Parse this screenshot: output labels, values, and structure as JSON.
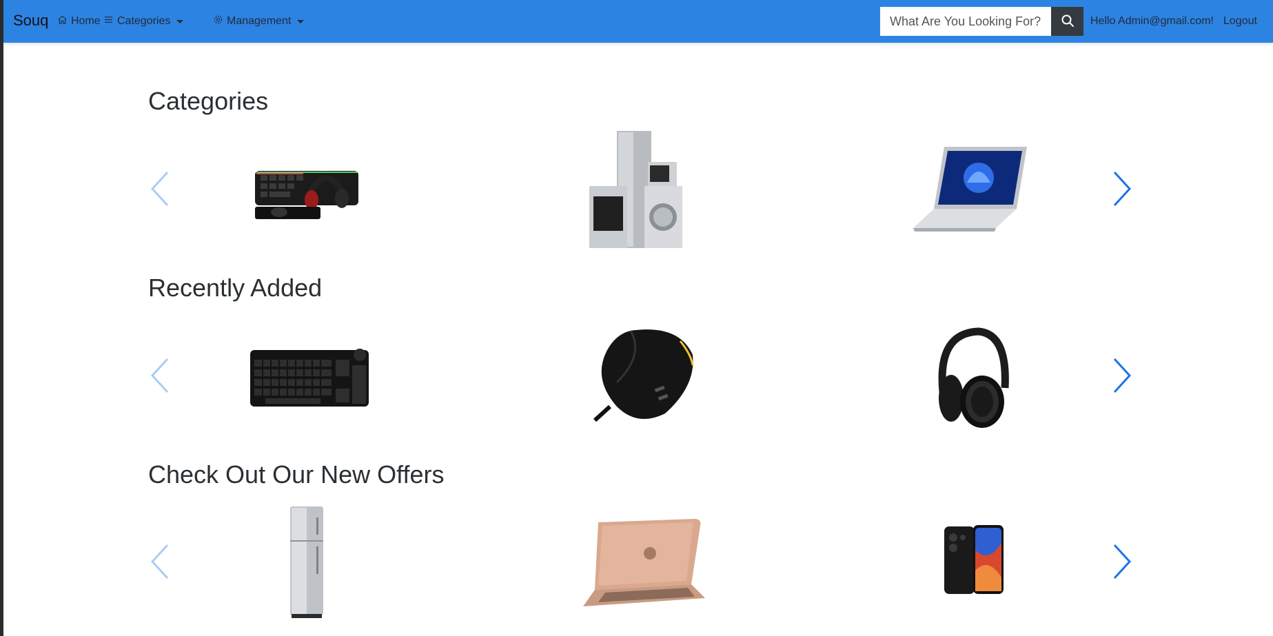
{
  "navbar": {
    "brand": "Souq",
    "home_label": "Home",
    "categories_label": "Categories",
    "management_label": "Management",
    "search_placeholder": "What Are You Looking For?",
    "greeting": "Hello Admin@gmail.com!",
    "logout_label": "Logout"
  },
  "sections": {
    "categories": {
      "title": "Categories",
      "items": [
        "gaming-peripherals-image",
        "home-appliances-image",
        "laptop-image"
      ]
    },
    "recent": {
      "title": "Recently Added",
      "items": [
        "keyboard-image",
        "mouse-image",
        "headphones-image"
      ]
    },
    "offers": {
      "title": "Check Out Our New Offers",
      "items": [
        "refrigerator-image",
        "macbook-image",
        "smartphone-image"
      ]
    }
  },
  "colors": {
    "navbar": "#2d83e2",
    "arrow_active": "#1a73e8",
    "arrow_disabled": "#a8cdf5",
    "search_button": "#343a40"
  }
}
